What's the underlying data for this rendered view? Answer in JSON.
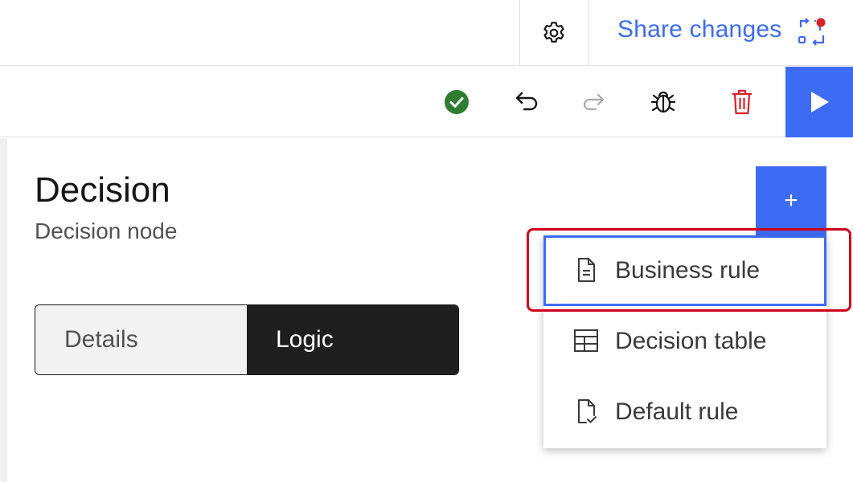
{
  "header": {
    "share_label": "Share changes",
    "settings_icon": "gear-icon",
    "share_icon": "share-sync-icon",
    "notification_color": "#da1e28"
  },
  "toolbar": {
    "status_icon": "checkmark-filled-icon",
    "status_color": "#24a148",
    "undo_icon": "undo-icon",
    "redo_icon": "redo-icon",
    "debug_icon": "bug-icon",
    "delete_icon": "trash-icon",
    "delete_color": "#da1e28",
    "run_icon": "play-icon",
    "accent_color": "#3d6bf3"
  },
  "node": {
    "title": "Decision",
    "subtitle": "Decision node"
  },
  "tabs": [
    {
      "label": "Details",
      "selected": false
    },
    {
      "label": "Logic",
      "selected": true
    }
  ],
  "add_button": {
    "label": "+"
  },
  "menu": {
    "items": [
      {
        "label": "Business rule",
        "icon": "document-icon",
        "focused": true
      },
      {
        "label": "Decision table",
        "icon": "table-icon",
        "focused": false
      },
      {
        "label": "Default rule",
        "icon": "document-check-icon",
        "focused": false
      }
    ]
  }
}
